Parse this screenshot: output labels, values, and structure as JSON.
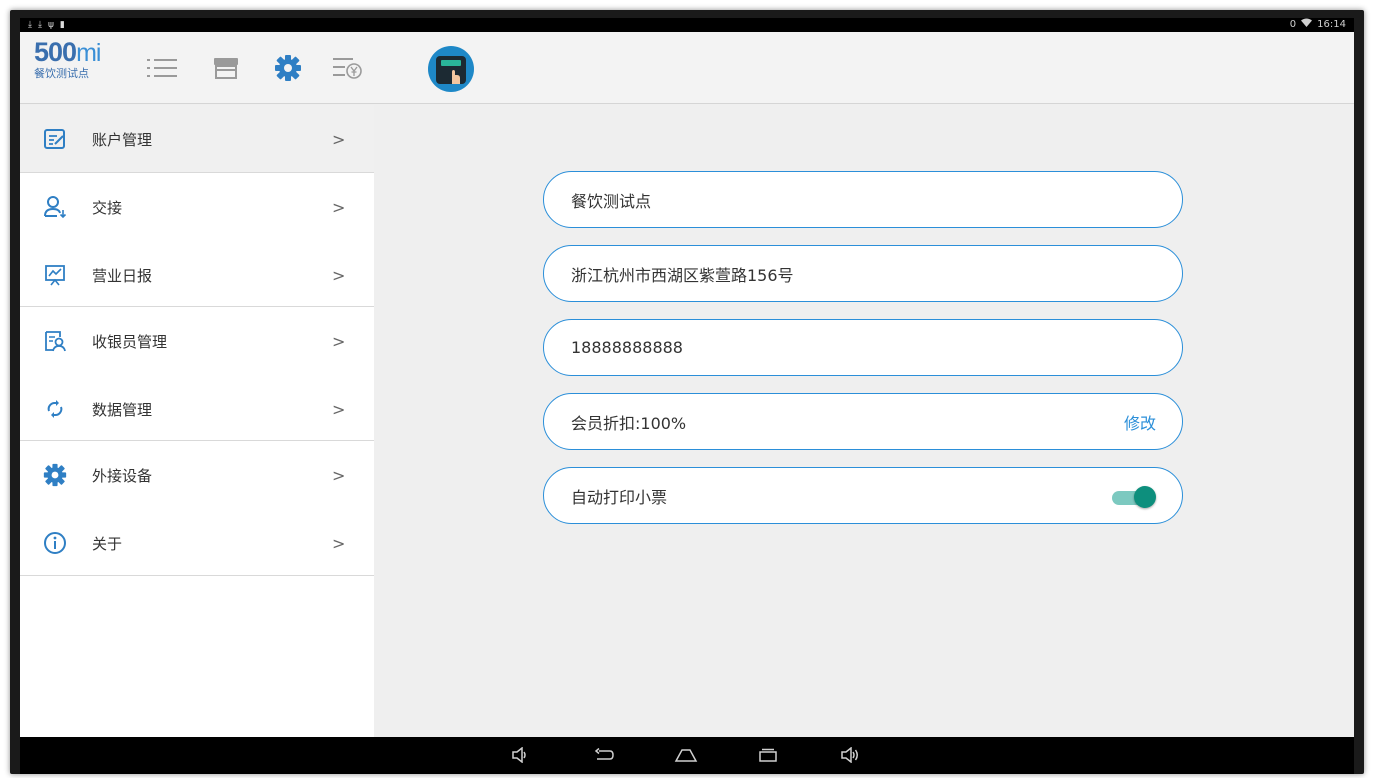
{
  "status_bar": {
    "left_icons": [
      "download-icon",
      "download-icon",
      "usb-icon",
      "battery-icon"
    ],
    "time": "16:14",
    "right_badge": "0"
  },
  "header": {
    "brand_number": "500",
    "brand_suffix": "mi",
    "brand_subtitle": "餐饮测试点",
    "icons": [
      "list-icon",
      "store-icon",
      "settings-gear-icon",
      "yen-list-icon"
    ],
    "active_icon": "settings-gear-icon",
    "accent_color": "#2b8fd9"
  },
  "sidebar": {
    "items": [
      {
        "label": "账户管理",
        "icon": "account-edit-icon"
      },
      {
        "label": "交接",
        "icon": "user-handover-icon"
      },
      {
        "label": "营业日报",
        "icon": "daily-report-icon"
      },
      {
        "label": "收银员管理",
        "icon": "cashier-icon"
      },
      {
        "label": "数据管理",
        "icon": "sync-icon"
      },
      {
        "label": "外接设备",
        "icon": "gear-icon"
      },
      {
        "label": "关于",
        "icon": "info-icon"
      }
    ],
    "arrow": ">"
  },
  "form": {
    "store_name": "餐饮测试点",
    "address": "浙江杭州市西湖区紫萱路156号",
    "phone": "18888888888",
    "member_discount": "会员折扣:100%",
    "member_discount_action": "修改",
    "auto_print_label": "自动打印小票",
    "auto_print_enabled": true
  },
  "navbar": {
    "buttons": [
      "volume-down-icon",
      "back-icon",
      "home-icon",
      "recents-icon",
      "volume-up-icon"
    ]
  }
}
